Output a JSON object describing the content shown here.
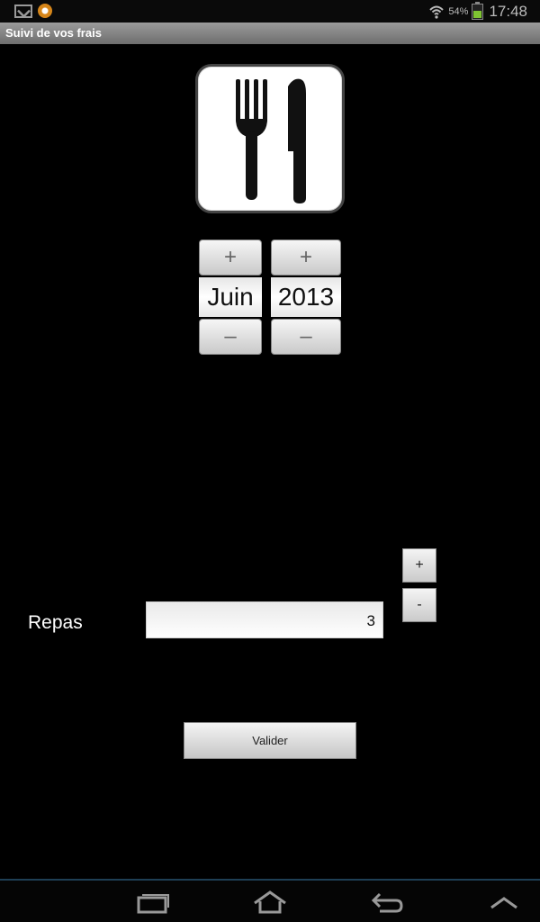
{
  "status_bar": {
    "notification_icons": [
      "gmail-icon",
      "notification-icon"
    ],
    "battery_percent": "54%",
    "time": "17:48",
    "battery_color": "#7fc432"
  },
  "app": {
    "title": "Suivi de vos frais"
  },
  "meal_icon": "fork-knife-icon",
  "date_picker": {
    "month": {
      "value": "Juin",
      "increment_label": "+",
      "decrement_label": "–"
    },
    "year": {
      "value": "2013",
      "increment_label": "+",
      "decrement_label": "–"
    }
  },
  "repas": {
    "label": "Repas",
    "value": "3",
    "plus_label": "+",
    "minus_label": "-"
  },
  "submit": {
    "label": "Valider"
  },
  "nav_bar": {
    "icons": [
      "recent-apps-icon",
      "home-icon",
      "back-icon",
      "menu-up-icon"
    ]
  }
}
